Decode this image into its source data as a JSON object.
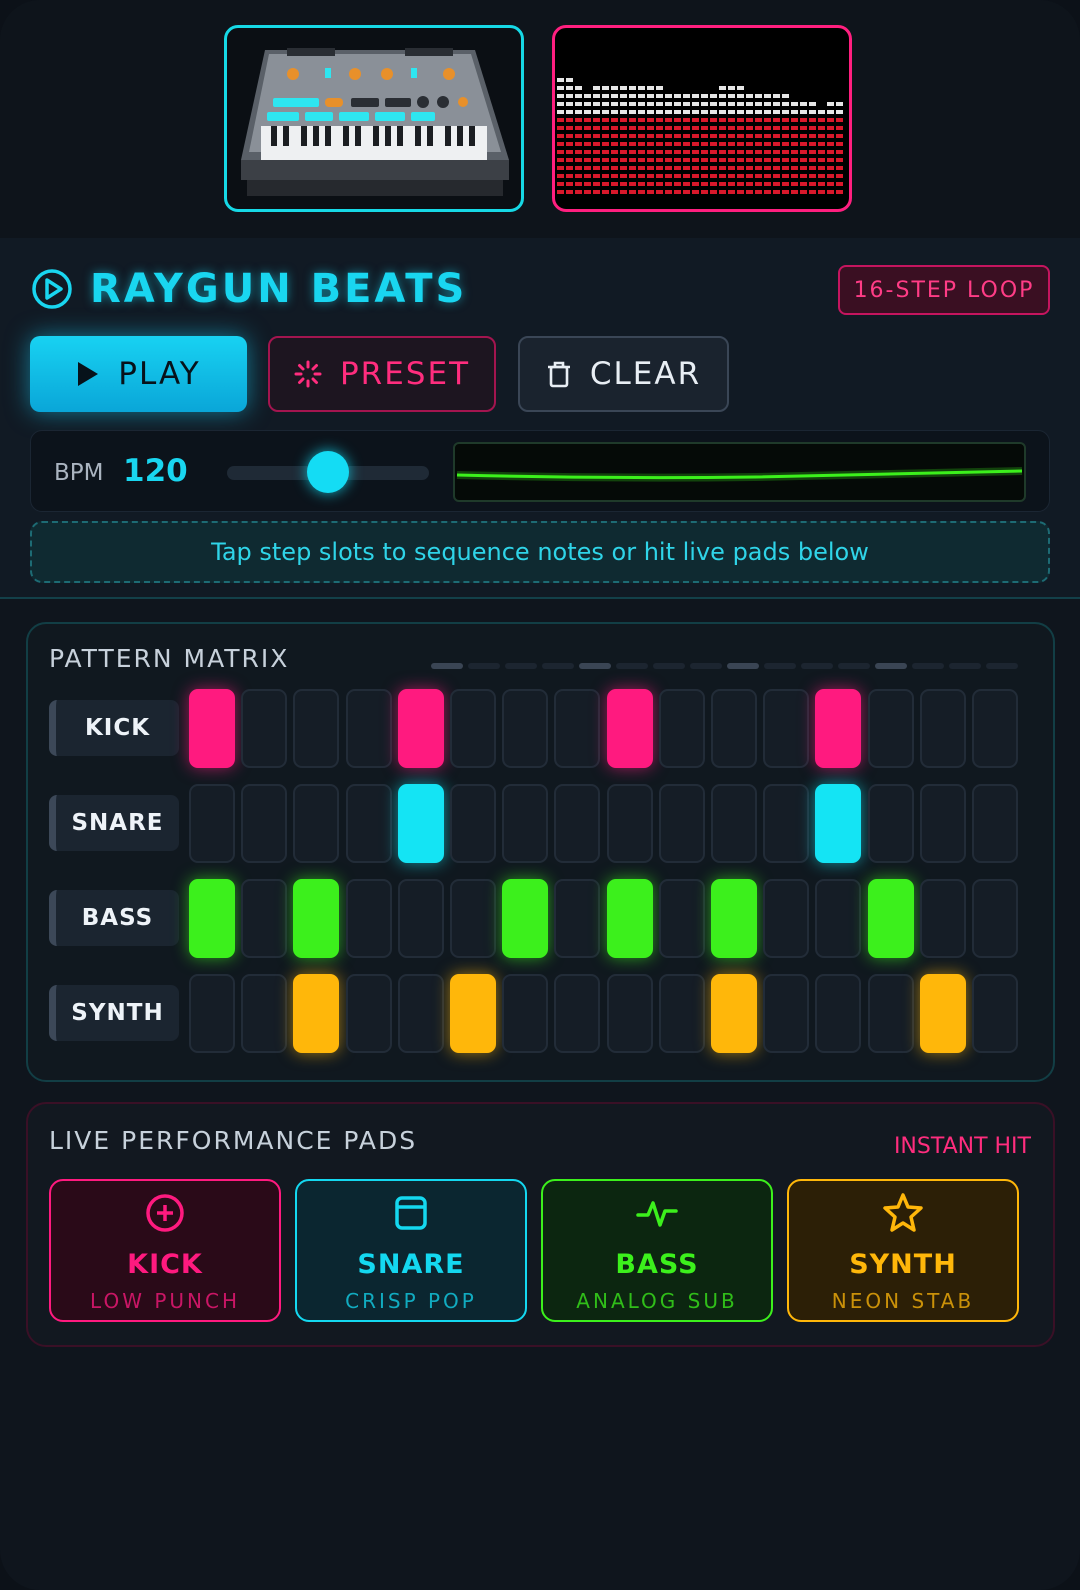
{
  "app": {
    "title": "RAYGUN BEATS",
    "loop_badge": "16-STEP LOOP"
  },
  "images": {
    "keys_alt": "retro synthesizer keyboard illustration",
    "eq_alt": "equalizer level meter"
  },
  "controls": {
    "play_label": "PLAY",
    "preset_label": "PRESET",
    "clear_label": "CLEAR"
  },
  "tempo": {
    "label": "BPM",
    "value": "120",
    "slider_fraction": 0.5
  },
  "hint": "Tap step slots to sequence notes or hit live pads below",
  "matrix": {
    "title": "PATTERN MATRIX",
    "steps": 16,
    "rows": [
      {
        "label": "KICK",
        "color": "#ff1a7f",
        "active": [
          0,
          4,
          8,
          12
        ]
      },
      {
        "label": "SNARE",
        "color": "#14e4f4",
        "active": [
          4,
          12
        ]
      },
      {
        "label": "BASS",
        "color": "#3cf01c",
        "active": [
          0,
          2,
          6,
          8,
          10,
          13
        ]
      },
      {
        "label": "SYNTH",
        "color": "#ffb70a",
        "active": [
          2,
          5,
          10,
          14
        ]
      }
    ]
  },
  "pads": {
    "title": "LIVE PERFORMANCE PADS",
    "tag": "INSTANT HIT",
    "items": [
      {
        "name": "KICK",
        "sub": "LOW PUNCH",
        "icon": "plus-circle-icon",
        "color": "#ff1a7f"
      },
      {
        "name": "SNARE",
        "sub": "CRISP POP",
        "icon": "drum-icon",
        "color": "#14d8f0"
      },
      {
        "name": "BASS",
        "sub": "ANALOG SUB",
        "icon": "pulse-icon",
        "color": "#3cf01c"
      },
      {
        "name": "SYNTH",
        "sub": "NEON STAB",
        "icon": "star-icon",
        "color": "#ffb70a"
      }
    ]
  }
}
